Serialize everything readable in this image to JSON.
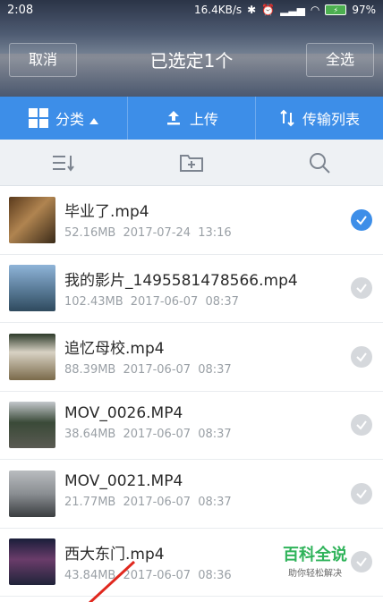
{
  "status": {
    "time": "2:08",
    "speed": "16.4KB/s",
    "battery": "97%"
  },
  "header": {
    "cancel_label": "取消",
    "title": "已选定1个",
    "select_all_label": "全选"
  },
  "toolbar": {
    "category_label": "分类",
    "upload_label": "上传",
    "transfer_label": "传输列表"
  },
  "colors": {
    "accent": "#3d8ee8"
  },
  "files": [
    {
      "name": "毕业了.mp4",
      "size": "52.16MB",
      "date": "2017-07-24",
      "time": "13:16",
      "checked": true
    },
    {
      "name": "我的影片_1495581478566.mp4",
      "size": "102.43MB",
      "date": "2017-06-07",
      "time": "08:37",
      "checked": false
    },
    {
      "name": "追忆母校.mp4",
      "size": "88.39MB",
      "date": "2017-06-07",
      "time": "08:37",
      "checked": false
    },
    {
      "name": "MOV_0026.MP4",
      "size": "38.64MB",
      "date": "2017-06-07",
      "time": "08:37",
      "checked": false
    },
    {
      "name": "MOV_0021.MP4",
      "size": "21.77MB",
      "date": "2017-06-07",
      "time": "08:37",
      "checked": false
    },
    {
      "name": "西大东门.mp4",
      "size": "43.84MB",
      "date": "2017-06-07",
      "time": "08:36",
      "checked": false
    }
  ],
  "watermark": {
    "title": "百科全说",
    "subtitle": "助你轻松解决"
  }
}
